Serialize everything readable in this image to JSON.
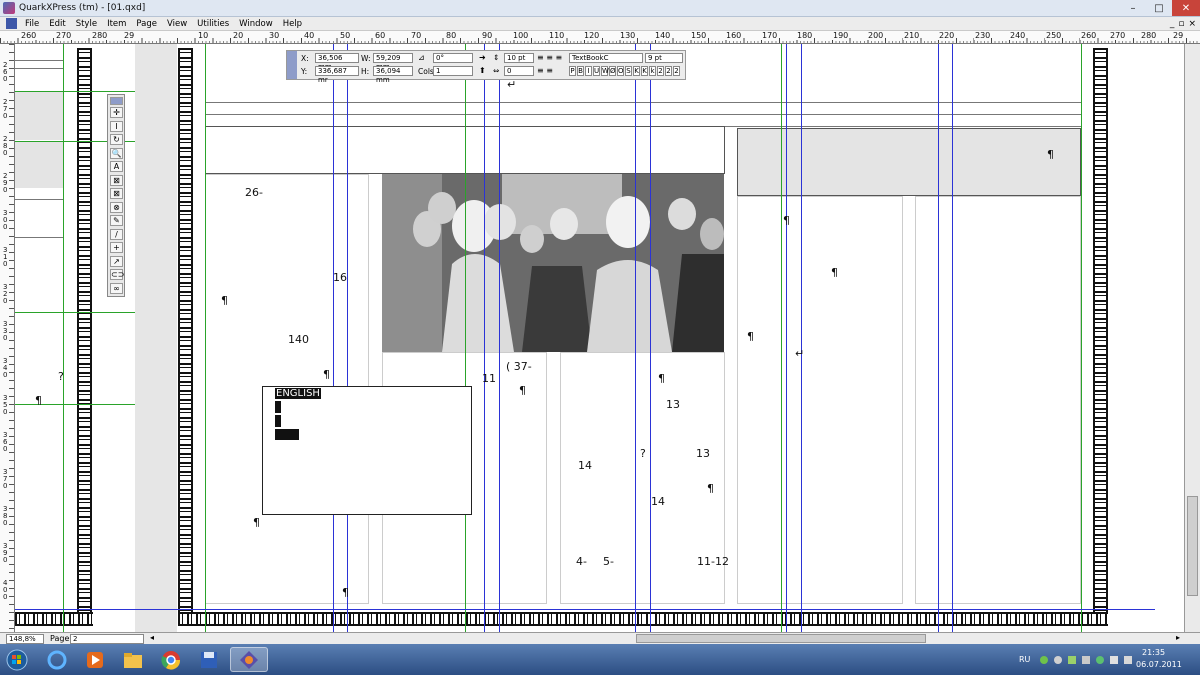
{
  "window": {
    "title": "QuarkXPress (tm) - [01.qxd]"
  },
  "controls": {
    "minimize": "–",
    "maximize": "□",
    "close": "✕",
    "mdi_min": "_",
    "mdi_restore": "▫",
    "mdi_close": "×"
  },
  "menu": {
    "items": [
      "File",
      "Edit",
      "Style",
      "Item",
      "Page",
      "View",
      "Utilities",
      "Window",
      "Help"
    ]
  },
  "ruler": {
    "labels": [
      "260",
      "270",
      "280",
      "29",
      "10",
      "20",
      "30",
      "40",
      "50",
      "60",
      "70",
      "80",
      "90",
      "100",
      "110",
      "120",
      "130",
      "140",
      "150",
      "160",
      "170",
      "180",
      "190",
      "200",
      "210",
      "220",
      "230",
      "240",
      "250",
      "260",
      "270",
      "280",
      "29"
    ]
  },
  "vruler": {
    "labels": [
      "2\n6\n0",
      "2\n7\n0",
      "2\n8\n0",
      "2\n9\n0",
      "3\n0\n0",
      "3\n1\n0",
      "3\n2\n0",
      "3\n3\n0",
      "3\n4\n0",
      "3\n5\n0",
      "3\n6\n0",
      "3\n7\n0",
      "3\n8\n0",
      "3\n9\n0",
      "4\n0\n0"
    ]
  },
  "measurements": {
    "x_label": "X:",
    "x_value": "36,506 mm",
    "y_label": "Y:",
    "y_value": "336,687 mr",
    "w_label": "W:",
    "w_value": "59,209 mm",
    "h_label": "H:",
    "h_value": "36,094 mm",
    "angle_value": "0°",
    "cols_label": "Cols:",
    "cols_value": "1",
    "leading_value": "10 pt",
    "tracking_value": "0",
    "font_value": "TextBookC",
    "size_value": "9 pt",
    "style_buttons": [
      "P",
      "B",
      "I",
      "U",
      "W",
      "Ø",
      "O",
      "S",
      "K",
      "K",
      "k",
      "2",
      "2",
      "2"
    ]
  },
  "tools": [
    "✛",
    "I",
    "↻",
    "🔍",
    "A",
    "⊠",
    "⊠",
    "⊗",
    "✎",
    "/",
    "+",
    "↗",
    "⊂⊃",
    "∞"
  ],
  "document": {
    "numbers": [
      "26-",
      "16",
      "140",
      "11",
      "( 37-",
      "13",
      "14",
      "13",
      "14",
      "4-",
      "5-",
      "11-12",
      "?",
      "?"
    ],
    "english": "ENGLISH"
  },
  "status": {
    "zoom": "148,8%",
    "page_label": "Page:",
    "page_value": "2"
  },
  "tray": {
    "lang": "RU",
    "time": "21:35",
    "date": "06.07.2011"
  },
  "colors": {
    "guide_blue": "#2b33d6",
    "guide_green": "#2aa32a",
    "taskbar": "#2c4e83"
  }
}
